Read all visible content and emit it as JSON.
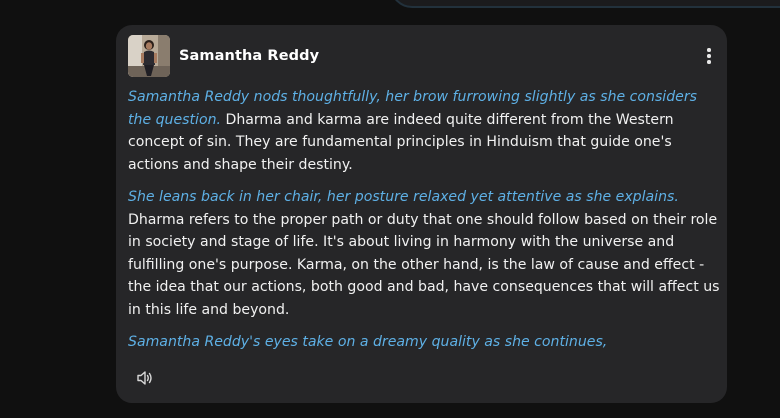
{
  "message": {
    "author": "Samantha Reddy",
    "avatar_icon": "profile-photo",
    "menu_icon": "more-vertical-icon",
    "paragraphs": [
      {
        "action": "Samantha Reddy nods thoughtfully, her brow furrowing slightly as she considers the question.",
        "text": " Dharma and karma are indeed quite different from the Western concept of sin. They are fundamental principles in Hinduism that guide one's actions and shape their destiny."
      },
      {
        "action": "She leans back in her chair, her posture relaxed yet attentive as she explains.",
        "text": " Dharma refers to the proper path or duty that one should follow based on their role in society and stage of life. It's about living in harmony with the universe and fulfilling one's purpose. Karma, on the other hand, is the law of cause and effect - the idea that our actions, both good and bad, have consequences that will affect us in this life and beyond."
      },
      {
        "action": "Samantha Reddy's eyes take on a dreamy quality as she continues,",
        "text": ""
      }
    ],
    "speaker_icon": "speaker-icon"
  },
  "colors": {
    "background": "#101010",
    "card": "#262628",
    "action_text": "#5eb0e5",
    "body_text": "#f1f1f1"
  }
}
